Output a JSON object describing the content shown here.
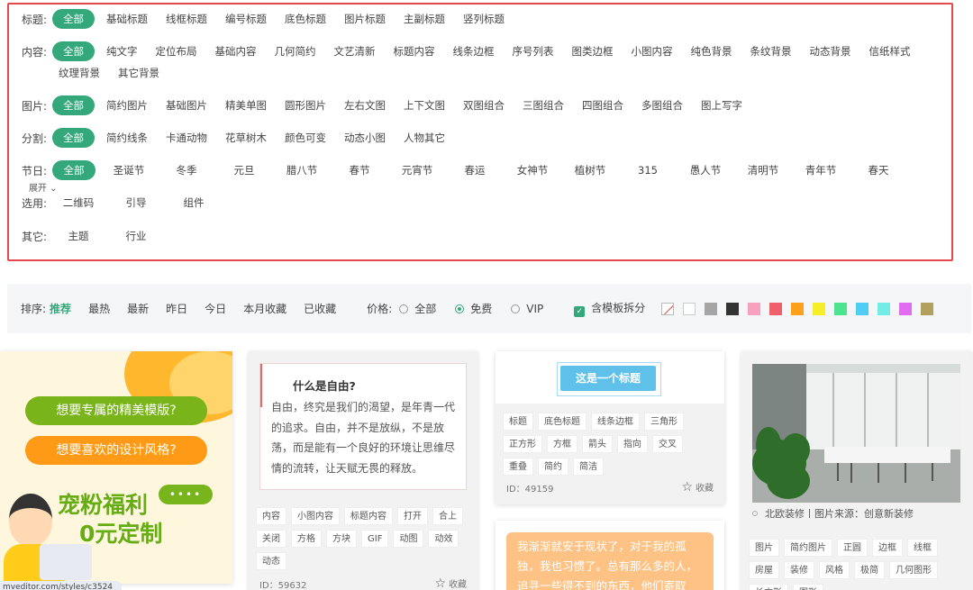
{
  "filters": [
    {
      "label": "标题:",
      "items": [
        "全部",
        "基础标题",
        "线框标题",
        "编号标题",
        "底色标题",
        "图片标题",
        "主副标题",
        "竖列标题"
      ]
    },
    {
      "label": "内容:",
      "items": [
        "全部",
        "纯文字",
        "定位布局",
        "基础内容",
        "几何简约",
        "文艺清新",
        "标题内容",
        "线条边框",
        "序号列表",
        "图类边框",
        "小图内容",
        "纯色背景",
        "条纹背景",
        "动态背景",
        "信纸样式",
        "纹理背景",
        "其它背景"
      ]
    },
    {
      "label": "图片:",
      "items": [
        "全部",
        "简约图片",
        "基础图片",
        "精美单图",
        "圆形图片",
        "左右文图",
        "上下文图",
        "双图组合",
        "三图组合",
        "四图组合",
        "多图组合",
        "图上写字"
      ]
    },
    {
      "label": "分割:",
      "items": [
        "全部",
        "简约线条",
        "卡通动物",
        "花草树木",
        "颜色可变",
        "动态小图",
        "人物其它"
      ]
    },
    {
      "label": "节日:",
      "items": [
        "全部",
        "圣诞节",
        "冬季",
        "元旦",
        "腊八节",
        "春节",
        "元宵节",
        "春运",
        "女神节",
        "植树节",
        "315",
        "愚人节",
        "清明节",
        "青年节",
        "春天"
      ],
      "expand": "展开 ⌄"
    },
    {
      "label": "选用:",
      "items": [
        "二维码",
        "引导",
        "组件"
      ]
    },
    {
      "label": "其它:",
      "items": [
        "主题",
        "行业"
      ]
    }
  ],
  "sort": {
    "label": "排序:",
    "items": [
      "推荐",
      "最热",
      "最新",
      "昨日",
      "今日",
      "本月收藏",
      "已收藏"
    ],
    "price_label": "价格:",
    "price_options": [
      "全部",
      "免费",
      "VIP"
    ],
    "split_label": "含模板拆分",
    "colors": [
      "#cccccc",
      "#ffffff",
      "#a5a5a5",
      "#333333",
      "#f7a1be",
      "#f0606a",
      "#ff9f1a",
      "#f7ee2a",
      "#4be48f",
      "#4fcdf3",
      "#74ece6",
      "#e26cf0",
      "#b2a15e"
    ]
  },
  "promo": {
    "pill1": "想要专属的精美模版?",
    "pill2": "想要喜欢的设计风格?",
    "line1": "宠粉福利",
    "line2": "0元定制",
    "bubble": "••••",
    "url": "mveditor.com/styles/c3524"
  },
  "card_text": {
    "title": "什么是自由?",
    "body": "自由，终究是我们的渴望，是年青一代的追求。自由，并不是放纵，不是放荡，而是能有一个良好的环境让思维尽情的流转，让天赋无畏的释放。",
    "tags": [
      "内容",
      "小图内容",
      "标题内容",
      "打开",
      "合上",
      "关闭",
      "方格",
      "方块",
      "GIF",
      "动图",
      "动效",
      "动态"
    ],
    "id": "ID：59632",
    "fav": "收藏"
  },
  "card_title": {
    "button": "这是一个标题",
    "tags": [
      "标题",
      "底色标题",
      "线条边框",
      "三角形",
      "正方形",
      "方框",
      "箭头",
      "指向",
      "交叉",
      "重叠",
      "简约",
      "简洁"
    ],
    "id": "ID：49159",
    "fav": "收藏"
  },
  "card_bottom": {
    "text": "我渐渐就安于现状了，对于我的孤独，我也习惯了。总有那么多的人，追寻一些得不到的东西，他们寄取"
  },
  "card_photo": {
    "caption": "北欧装修丨图片来源：创意新装修",
    "tags": [
      "图片",
      "简约图片",
      "正圆",
      "边框",
      "线框",
      "房屋",
      "装修",
      "风格",
      "极简",
      "几何图形",
      "长方形",
      "图形"
    ]
  }
}
